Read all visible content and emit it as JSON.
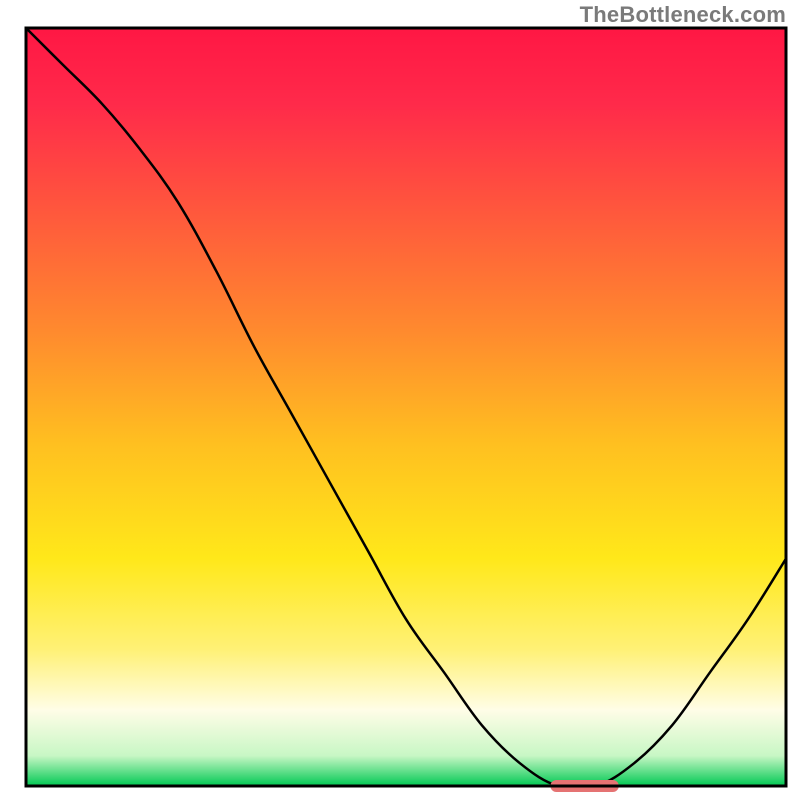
{
  "watermark": "TheBottleneck.com",
  "chart_data": {
    "type": "line",
    "title": "",
    "xlabel": "",
    "ylabel": "",
    "xlim": [
      0,
      100
    ],
    "ylim": [
      0,
      100
    ],
    "x": [
      0,
      5,
      10,
      15,
      20,
      25,
      30,
      35,
      40,
      45,
      50,
      55,
      60,
      65,
      70,
      75,
      80,
      85,
      90,
      95,
      100
    ],
    "values": [
      100,
      95,
      90,
      84,
      77,
      68,
      58,
      49,
      40,
      31,
      22,
      15,
      8,
      3,
      0,
      0,
      3,
      8,
      15,
      22,
      30
    ],
    "optimum_marker": {
      "x_start": 69,
      "x_end": 78,
      "y": 0
    },
    "gradient_stops": [
      {
        "offset": 0.0,
        "color": "#ff1744"
      },
      {
        "offset": 0.1,
        "color": "#ff2a4a"
      },
      {
        "offset": 0.25,
        "color": "#ff5a3c"
      },
      {
        "offset": 0.4,
        "color": "#ff8a2e"
      },
      {
        "offset": 0.55,
        "color": "#ffc020"
      },
      {
        "offset": 0.7,
        "color": "#ffe81a"
      },
      {
        "offset": 0.82,
        "color": "#fff176"
      },
      {
        "offset": 0.9,
        "color": "#fffde7"
      },
      {
        "offset": 0.96,
        "color": "#c8f7c5"
      },
      {
        "offset": 1.0,
        "color": "#00c853"
      }
    ]
  }
}
